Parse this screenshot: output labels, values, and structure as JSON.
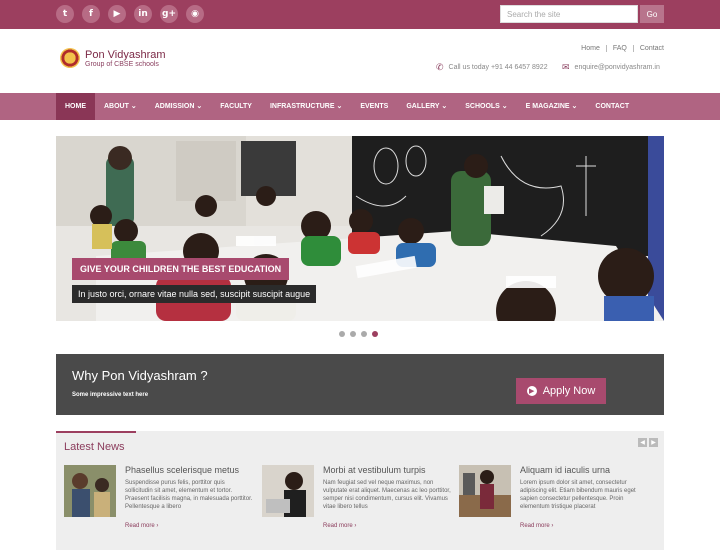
{
  "social": {
    "icons": [
      {
        "name": "twitter-icon",
        "glyph": "t"
      },
      {
        "name": "facebook-icon",
        "glyph": "f"
      },
      {
        "name": "youtube-icon",
        "glyph": "▶"
      },
      {
        "name": "linkedin-icon",
        "glyph": "in"
      },
      {
        "name": "googleplus-icon",
        "glyph": "g+"
      },
      {
        "name": "rss-icon",
        "glyph": "◉"
      }
    ]
  },
  "search": {
    "placeholder": "Search the site",
    "button_label": "Go"
  },
  "brand": {
    "name": "Pon Vidyashram",
    "tagline": "Group of CBSE schools"
  },
  "toplinks": [
    "Home",
    "FAQ",
    "Contact"
  ],
  "contact": {
    "phone": "Call us today +91 44 6457 8922",
    "email": "enquire@ponvidyashram.in"
  },
  "nav": {
    "items": [
      {
        "label": "HOME",
        "active": true
      },
      {
        "label": "ABOUT ⌄"
      },
      {
        "label": "ADMISSION ⌄"
      },
      {
        "label": "FACULTY"
      },
      {
        "label": "INFRASTRUCTURE ⌄"
      },
      {
        "label": "EVENTS"
      },
      {
        "label": "GALLERY ⌄"
      },
      {
        "label": "SCHOOLS ⌄"
      },
      {
        "label": "E MAGAZINE ⌄"
      },
      {
        "label": "CONTACT"
      }
    ]
  },
  "slider": {
    "caption_title": "GIVE YOUR CHILDREN THE BEST EDUCATION",
    "caption_sub": "In justo orci, ornare vitae nulla sed, suscipit suscipit augue",
    "active_dot": 3,
    "dot_count": 4
  },
  "why": {
    "title": "Why Pon Vidyashram ?",
    "subtitle": "Some impressive text here",
    "apply_label": "Apply Now"
  },
  "news": {
    "title": "Latest News",
    "items": [
      {
        "title": "Phasellus scelerisque metus",
        "body": "Suspendisse purus felis, porttitor quis sollicitudin sit amet, elementum et tortor. Praesent facilisis magna, in malesuada porttitor. Pellentesque a libero",
        "more": "Read more ›"
      },
      {
        "title": "Morbi at vestibulum turpis",
        "body": "Nam feugiat sed vel neque maximus, non vulputate erat aliquet. Maecenas ac leo porttitor, semper nisi condimentum, cursus elit. Vivamus vitae libero tellus",
        "more": "Read more ›"
      },
      {
        "title": "Aliquam id iaculis urna",
        "body": "Lorem ipsum dolor sit amet, consectetur adipiscing elit. Etiam bibendum mauris eget sapien consectetur pellentesque. Proin elementum tristique placerat",
        "more": "Read more ›"
      }
    ]
  }
}
